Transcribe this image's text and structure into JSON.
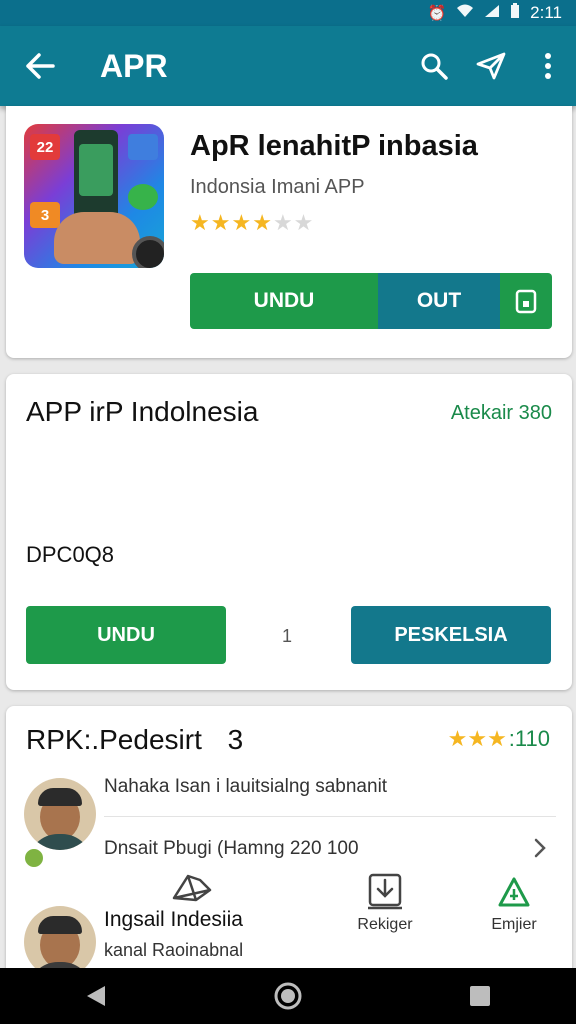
{
  "status_bar": {
    "time": "2:11",
    "icons": [
      "alarm-icon",
      "wifi-icon",
      "signal-icon",
      "battery-icon"
    ]
  },
  "app_bar": {
    "title": "APR",
    "actions": [
      "search-icon",
      "send-icon",
      "more-vert-icon"
    ]
  },
  "app_card": {
    "title": "ApR lenahitP inbasia",
    "subtitle": "Indonsia Imani APP",
    "rating": 3.5,
    "primary_button": "UNDU",
    "secondary_button": "OUT",
    "icon_tiles": [
      "22",
      "3"
    ]
  },
  "detail_card": {
    "title": "APP irP Indolnesia",
    "right_label": "Atekair 380",
    "code": "DPC0Q8",
    "middle_label": "1",
    "left_button": "UNDU",
    "right_button": "PESKELSIA"
  },
  "review_card": {
    "title": "RPK:.Pedesirt",
    "title_count": "3",
    "rating_value": "110",
    "line1": "Nahaka Isan i lauitsialng sabnanit",
    "line2": "Dnsait Pbugi (Hamng 220 100",
    "reviewer_name": "Ingsail Indesiia",
    "reviewer_sub": "kanal Raoinabnal"
  },
  "bottom_actions": [
    {
      "label": "",
      "icon": "share-icon"
    },
    {
      "label": "Rekiger",
      "icon": "download-icon"
    },
    {
      "label": "Emjier",
      "icon": "recycle-icon"
    }
  ],
  "colors": {
    "primary": "#0e7b92",
    "green": "#1e9a4a",
    "teal": "#13788c",
    "star": "#f5b621"
  }
}
